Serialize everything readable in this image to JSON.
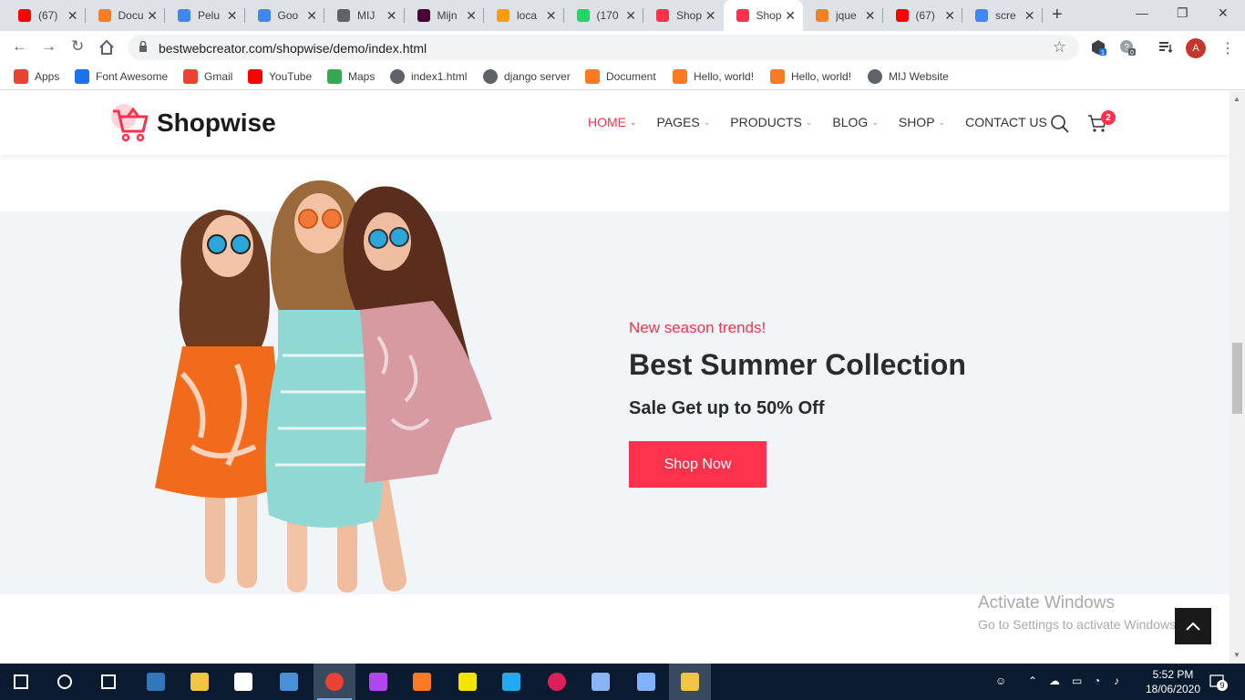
{
  "browser": {
    "tabs": [
      {
        "title": "(67)",
        "icon": "youtube-icon",
        "color": "#ff0000"
      },
      {
        "title": "Docu",
        "icon": "xampp-icon",
        "color": "#fb7a24"
      },
      {
        "title": "Pelu",
        "icon": "shield-icon",
        "color": "#4285f4"
      },
      {
        "title": "Goo",
        "icon": "google-icon",
        "color": "#4285f4"
      },
      {
        "title": "MIJ",
        "icon": "globe-icon",
        "color": "#5f6368"
      },
      {
        "title": "Mijn",
        "icon": "adobe-xd-icon",
        "color": "#470137"
      },
      {
        "title": "loca",
        "icon": "phpmyadmin-icon",
        "color": "#f89c0e"
      },
      {
        "title": "(170",
        "icon": "whatsapp-icon",
        "color": "#25d366"
      },
      {
        "title": "Shop",
        "icon": "shopwise-icon",
        "color": "#ff324d"
      },
      {
        "title": "Shop",
        "icon": "shopwise-icon",
        "color": "#ff324d"
      },
      {
        "title": "jque",
        "icon": "stackoverflow-icon",
        "color": "#f48024"
      },
      {
        "title": "(67)",
        "icon": "youtube-icon",
        "color": "#ff0000"
      },
      {
        "title": "scre",
        "icon": "google-icon",
        "color": "#4285f4"
      }
    ],
    "active_tab_index": 9,
    "url": "bestwebcreator.com/shopwise/demo/index.html",
    "avatar_letter": "A",
    "bookmarks": [
      {
        "label": "Apps",
        "icon": "apps-grid-icon"
      },
      {
        "label": "Font Awesome",
        "icon": "flag-icon"
      },
      {
        "label": "Gmail",
        "icon": "gmail-icon"
      },
      {
        "label": "YouTube",
        "icon": "youtube-icon"
      },
      {
        "label": "Maps",
        "icon": "maps-pin-icon"
      },
      {
        "label": "index1.html",
        "icon": "globe-icon"
      },
      {
        "label": "django server",
        "icon": "globe-icon"
      },
      {
        "label": "Document",
        "icon": "xampp-icon"
      },
      {
        "label": "Hello, world!",
        "icon": "xampp-icon"
      },
      {
        "label": "Hello, world!",
        "icon": "xampp-icon"
      },
      {
        "label": "MIJ Website",
        "icon": "globe-icon"
      }
    ],
    "extension_badges": [
      "1",
      "0"
    ]
  },
  "site": {
    "logo_text": "Shopwise",
    "nav": [
      {
        "label": "HOME",
        "active": true,
        "has_dropdown": true
      },
      {
        "label": "PAGES",
        "active": false,
        "has_dropdown": true
      },
      {
        "label": "PRODUCTS",
        "active": false,
        "has_dropdown": true
      },
      {
        "label": "BLOG",
        "active": false,
        "has_dropdown": true
      },
      {
        "label": "SHOP",
        "active": false,
        "has_dropdown": true
      },
      {
        "label": "CONTACT US",
        "active": false,
        "has_dropdown": false
      }
    ],
    "cart_count": "2",
    "hero": {
      "tagline": "New season trends!",
      "title": "Best Summer Collection",
      "subtitle": "Sale Get up to 50% Off",
      "button": "Shop Now"
    },
    "accent_color": "#ff324d"
  },
  "windows_watermark": {
    "line1": "Activate Windows",
    "line2": "Go to Settings to activate Windows."
  },
  "taskbar": {
    "time": "5:52 PM",
    "date": "18/06/2020",
    "notification_count": "9",
    "apps": [
      "start-icon",
      "search-icon",
      "task-view-icon",
      "edge-icon",
      "file-explorer-icon",
      "store-icon",
      "mail-icon",
      "chrome-icon",
      "phpstorm-icon",
      "xampp-icon",
      "sticky-notes-icon",
      "vscode-icon",
      "slack-icon",
      "notepad-icon",
      "git-icon",
      "file-manager-icon"
    ]
  }
}
